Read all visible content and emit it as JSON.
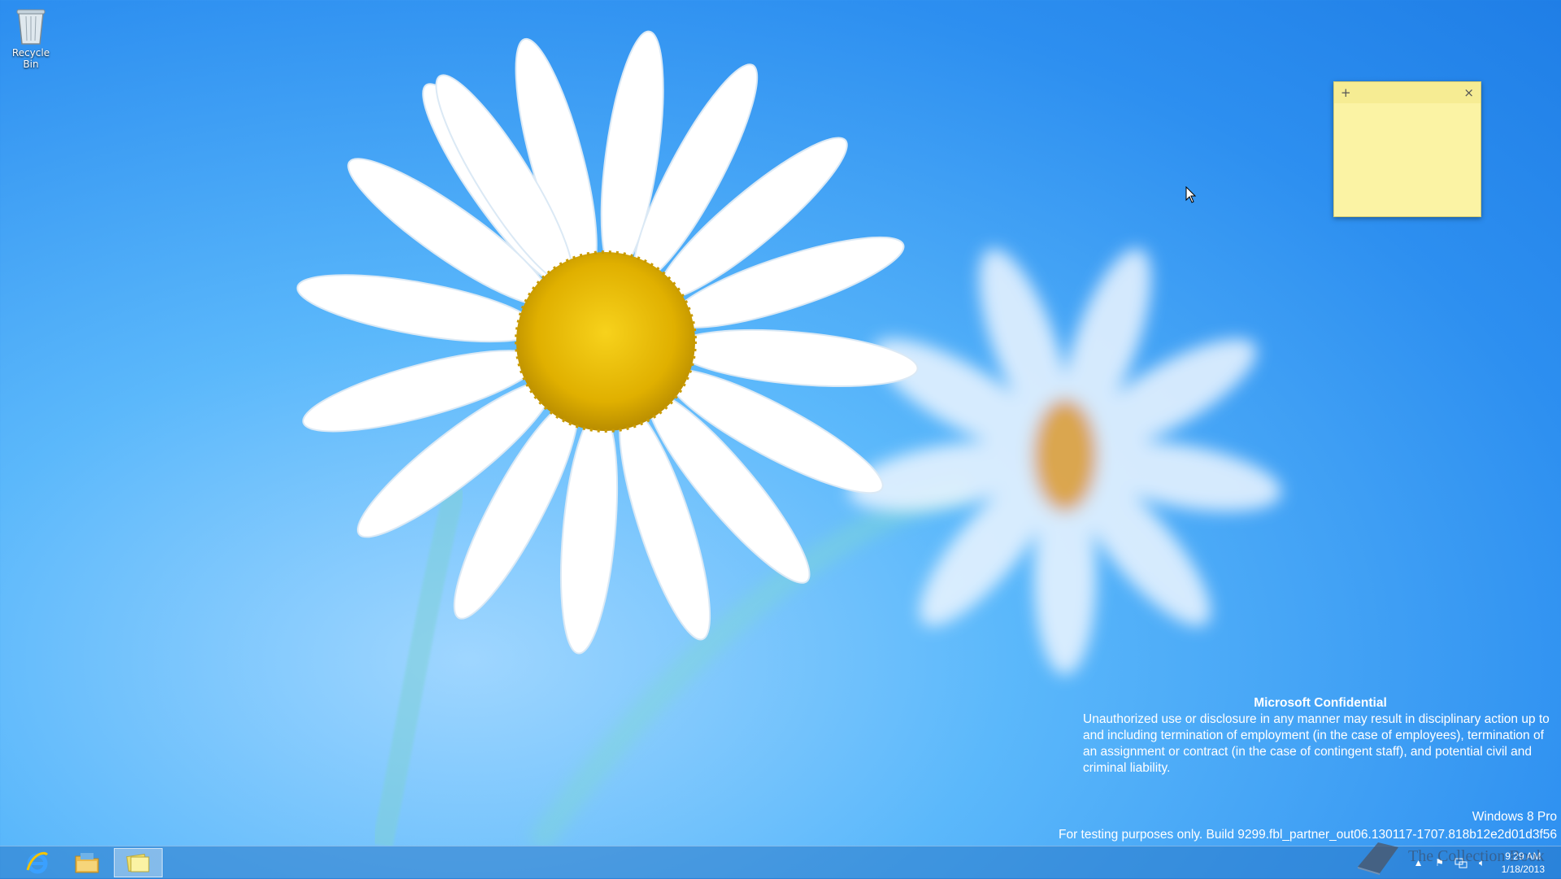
{
  "desktop": {
    "icons": [
      {
        "label": "Recycle Bin",
        "icon": "recycle-bin-icon"
      }
    ]
  },
  "sticky_note": {
    "add_symbol": "+",
    "close_symbol": "×",
    "text": ""
  },
  "confidential": {
    "title": "Microsoft Confidential",
    "body": "Unauthorized use or disclosure in any manner may result in disciplinary action up to and including termination of employment (in the case of employees), termination of an assignment or contract (in the case of contingent staff), and potential civil and criminal liability."
  },
  "watermark": {
    "edition": "Windows 8 Pro",
    "build": "For testing purposes only. Build 9299.fbl_partner_out06.130117-1707.818b12e2d01d3f56"
  },
  "taskbar": {
    "pinned": [
      {
        "name": "internet-explorer",
        "icon": "ie-icon"
      },
      {
        "name": "file-explorer",
        "icon": "folder-icon"
      },
      {
        "name": "sticky-notes",
        "icon": "sticky-notes-icon",
        "active": true
      }
    ],
    "tray": {
      "icons": [
        "chevron-up-icon",
        "flag-icon",
        "network-icon",
        "speaker-icon"
      ],
      "time": "9:29 AM",
      "date": "1/18/2013"
    }
  },
  "overlay_logo": {
    "text": "The Collection Book"
  },
  "colors": {
    "sticky": "#fbf3a4",
    "taskbar": "#2878c8",
    "background": "#2d8ff0"
  }
}
